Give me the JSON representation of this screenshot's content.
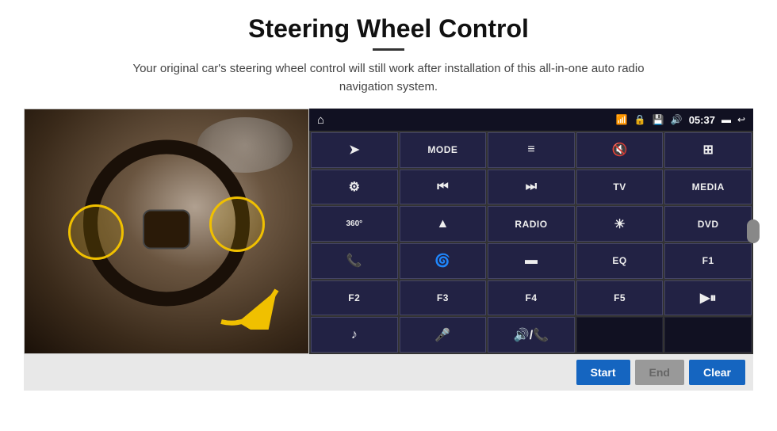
{
  "page": {
    "title": "Steering Wheel Control",
    "subtitle": "Your original car's steering wheel control will still work after installation of this all-in-one auto radio navigation system.",
    "divider": "—"
  },
  "status_bar": {
    "home_icon": "⌂",
    "wifi_icon": "📶",
    "lock_icon": "🔒",
    "sd_icon": "💾",
    "bt_icon": "🔊",
    "time": "05:37",
    "screen_icon": "▬",
    "back_icon": "↩"
  },
  "buttons": [
    {
      "id": "r1c1",
      "label": "➤",
      "type": "icon"
    },
    {
      "id": "r1c2",
      "label": "MODE",
      "type": "text"
    },
    {
      "id": "r1c3",
      "label": "≡",
      "type": "icon"
    },
    {
      "id": "r1c4",
      "label": "🔇",
      "type": "icon"
    },
    {
      "id": "r1c5",
      "label": "⊞",
      "type": "icon"
    },
    {
      "id": "r2c1",
      "label": "⚙",
      "type": "icon"
    },
    {
      "id": "r2c2",
      "label": "⏮",
      "type": "icon"
    },
    {
      "id": "r2c3",
      "label": "⏭",
      "type": "icon"
    },
    {
      "id": "r2c4",
      "label": "TV",
      "type": "text"
    },
    {
      "id": "r2c5",
      "label": "MEDIA",
      "type": "text"
    },
    {
      "id": "r3c1",
      "label": "360°",
      "type": "text-sm"
    },
    {
      "id": "r3c2",
      "label": "▲",
      "type": "icon"
    },
    {
      "id": "r3c3",
      "label": "RADIO",
      "type": "text"
    },
    {
      "id": "r3c4",
      "label": "☀",
      "type": "icon"
    },
    {
      "id": "r3c5",
      "label": "DVD",
      "type": "text"
    },
    {
      "id": "r4c1",
      "label": "📞",
      "type": "icon"
    },
    {
      "id": "r4c2",
      "label": "🌀",
      "type": "icon"
    },
    {
      "id": "r4c3",
      "label": "▬",
      "type": "icon"
    },
    {
      "id": "r4c4",
      "label": "EQ",
      "type": "text"
    },
    {
      "id": "r4c5",
      "label": "F1",
      "type": "text"
    },
    {
      "id": "r5c1",
      "label": "F2",
      "type": "text"
    },
    {
      "id": "r5c2",
      "label": "F3",
      "type": "text"
    },
    {
      "id": "r5c3",
      "label": "F4",
      "type": "text"
    },
    {
      "id": "r5c4",
      "label": "F5",
      "type": "text"
    },
    {
      "id": "r5c5",
      "label": "▶⏸",
      "type": "icon"
    },
    {
      "id": "r6c1",
      "label": "♪",
      "type": "icon"
    },
    {
      "id": "r6c2",
      "label": "🎤",
      "type": "icon"
    },
    {
      "id": "r6c3",
      "label": "🔊/📞",
      "type": "icon"
    },
    {
      "id": "r6c4",
      "label": "",
      "type": "empty"
    },
    {
      "id": "r6c5",
      "label": "",
      "type": "empty"
    }
  ],
  "bottom_buttons": {
    "start": "Start",
    "end": "End",
    "clear": "Clear"
  }
}
